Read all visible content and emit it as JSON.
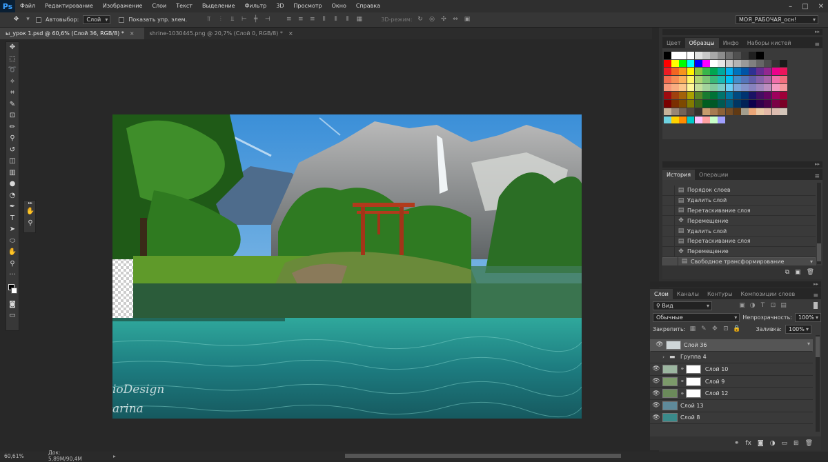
{
  "app": {
    "logo": "Ps"
  },
  "menu": [
    "Файл",
    "Редактирование",
    "Изображение",
    "Слои",
    "Текст",
    "Выделение",
    "Фильтр",
    "3D",
    "Просмотр",
    "Окно",
    "Справка"
  ],
  "options": {
    "autoselect_label": "Автовыбор:",
    "autoselect_value": "Слой",
    "show_controls_label": "Показать упр. элем.",
    "mode3d_label": "3D-режим:",
    "workspace": "МОЯ_РАБОЧАЯ_осн!"
  },
  "tabs": [
    {
      "label": "ы_урок 1.psd @ 60,6% (Слой 36, RGB/8) *",
      "close": "×"
    },
    {
      "label": "shrine-1030445.png @ 20,7% (Слой 0, RGB/8) *",
      "close": "×"
    }
  ],
  "canvas": {
    "watermark_line1": "ioDesign",
    "watermark_line2": "arina"
  },
  "swatches_panel": {
    "tabs": [
      "Цвет",
      "Образцы",
      "Инфо",
      "Наборы кистей"
    ],
    "active_tab": 1,
    "colors": [
      [
        "#000000",
        "#ffffff",
        "#ffffff",
        "#ffffff",
        "#e0e0e0",
        "#c8c8c8",
        "#a8a8a8",
        "#8c8c8c",
        "#6e6e6e",
        "#505050",
        "#383838",
        "#202020",
        "#000000"
      ],
      [
        "#ff0000",
        "#ffff00",
        "#00ff00",
        "#00ffff",
        "#0000ff",
        "#ff00ff",
        "#ffffff",
        "#e6e6e6",
        "#cccccc",
        "#b3b3b3",
        "#999999",
        "#808080",
        "#666666",
        "#4d4d4d",
        "#333333",
        "#1a1a1a"
      ],
      [
        "#ed1c24",
        "#f26522",
        "#f7941d",
        "#fff200",
        "#8dc63f",
        "#39b54a",
        "#00a651",
        "#00a99d",
        "#00aeef",
        "#0072bc",
        "#0054a6",
        "#2e3192",
        "#662d91",
        "#92278f",
        "#ec008c",
        "#ed145b"
      ],
      [
        "#f26c4f",
        "#f68e56",
        "#fbaf5d",
        "#fff568",
        "#acd372",
        "#7cc576",
        "#3bb878",
        "#1abbb4",
        "#00bff3",
        "#438cca",
        "#5574b9",
        "#605ca8",
        "#8560a8",
        "#a763a8",
        "#f06eaa",
        "#f26d7d"
      ],
      [
        "#f7977a",
        "#f9ad81",
        "#fdc68a",
        "#fff79a",
        "#c4df9b",
        "#a3d39c",
        "#82ca9d",
        "#7bcdc8",
        "#6ecff6",
        "#7ea7d8",
        "#8493ca",
        "#8882be",
        "#a187be",
        "#bc8dbf",
        "#f49ac2",
        "#f6989d"
      ],
      [
        "#9e0b0f",
        "#a0410d",
        "#a36209",
        "#aba000",
        "#598527",
        "#1a7b30",
        "#007236",
        "#00746b",
        "#0076a3",
        "#004a80",
        "#003471",
        "#1b1464",
        "#440e62",
        "#630460",
        "#9e005d",
        "#9e0039"
      ],
      [
        "#790000",
        "#7b2e00",
        "#7d4900",
        "#827b00",
        "#406618",
        "#005e20",
        "#005826",
        "#005952",
        "#005b7f",
        "#003663",
        "#002157",
        "#0d004c",
        "#32004b",
        "#4b0049",
        "#7b0046",
        "#7a0026"
      ],
      [
        "#c7b299",
        "#998675",
        "#736357",
        "#534741",
        "#37302d",
        "#c69c6d",
        "#a67c52",
        "#8c6239",
        "#754c24",
        "#603913",
        "#a39e8e",
        "#eaa678",
        "#e9c8a6",
        "#e3b8a7",
        "#ddbcb0",
        "#d4c6ba"
      ],
      [
        "#6ed2e0",
        "#ffd200",
        "#ff8c00",
        "#00c8c8",
        "#ffc0ff",
        "#ffa0a0",
        "#c8ffc8",
        "#a0a0ff"
      ]
    ]
  },
  "history_panel": {
    "tabs": [
      "История",
      "Операции"
    ],
    "items": [
      {
        "icon": "doc",
        "label": "Порядок слоев"
      },
      {
        "icon": "doc",
        "label": "Удалить слой"
      },
      {
        "icon": "doc",
        "label": "Перетаскивание слоя"
      },
      {
        "icon": "move",
        "label": "Перемещение"
      },
      {
        "icon": "doc",
        "label": "Удалить слой"
      },
      {
        "icon": "doc",
        "label": "Перетаскивание слоя"
      },
      {
        "icon": "move",
        "label": "Перемещение"
      },
      {
        "icon": "doc",
        "label": "Свободное трансформирование"
      }
    ]
  },
  "layers_panel": {
    "tabs": [
      "Слои",
      "Каналы",
      "Контуры",
      "Композиции слоев"
    ],
    "filter": "Вид",
    "blend_mode": "Обычные",
    "opacity_label": "Непрозрачность:",
    "opacity": "100%",
    "lock_label": "Закрепить:",
    "fill_label": "Заливка:",
    "fill": "100%",
    "layers": [
      {
        "name": "Слой 36",
        "visible": true,
        "group": false,
        "mask": false,
        "selected": true
      },
      {
        "name": "Группа 4",
        "visible": false,
        "group": true,
        "mask": false,
        "selected": false
      },
      {
        "name": "Слой 10",
        "visible": true,
        "group": false,
        "mask": true,
        "selected": false
      },
      {
        "name": "Слой 9",
        "visible": true,
        "group": false,
        "mask": true,
        "selected": false
      },
      {
        "name": "Слой 12",
        "visible": true,
        "group": false,
        "mask": true,
        "selected": false
      },
      {
        "name": "Слой 13",
        "visible": true,
        "group": false,
        "mask": false,
        "selected": false
      },
      {
        "name": "Слой 8",
        "visible": true,
        "group": false,
        "mask": false,
        "selected": false
      }
    ]
  },
  "status": {
    "zoom": "60,61%",
    "doc": "Док: 5,89М/90,4М"
  }
}
